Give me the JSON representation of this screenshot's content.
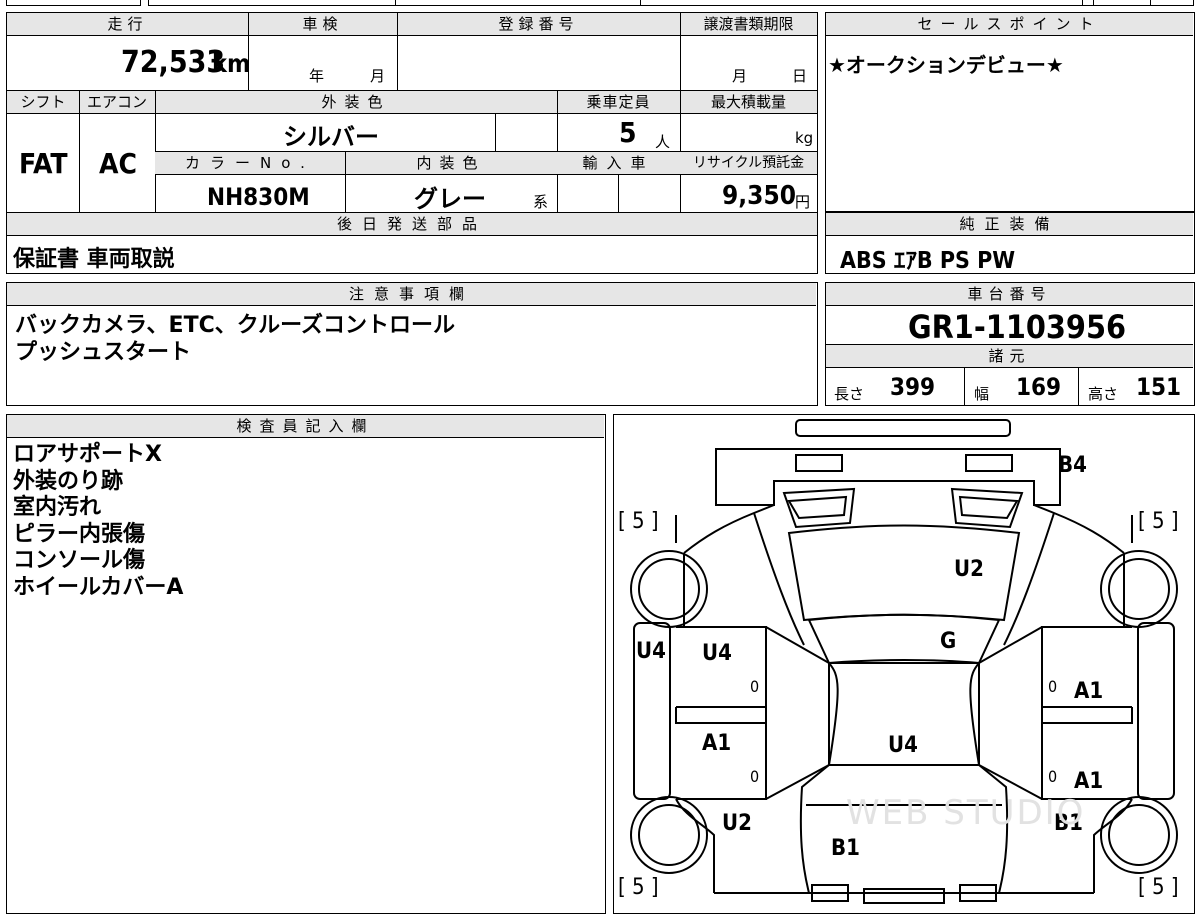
{
  "mileage": {
    "header": "走行",
    "value": "72,533",
    "unit": "km"
  },
  "inspection": {
    "header": "車検",
    "year_unit": "年",
    "month_unit": "月"
  },
  "registration": {
    "header": "登録番号"
  },
  "transfer_deadline": {
    "header": "譲渡書類期限",
    "month_unit": "月",
    "day_unit": "日"
  },
  "sales_point": {
    "header": "セールスポイント",
    "text": "★オークションデビュー★"
  },
  "shift": {
    "header": "シフト",
    "value": "FAT"
  },
  "aircon": {
    "header": "エアコン",
    "value": "AC"
  },
  "exterior_color": {
    "header": "外装色",
    "value": "シルバー"
  },
  "capacity": {
    "header": "乗車定員",
    "value": "5",
    "unit": "人"
  },
  "max_load": {
    "header": "最大積載量",
    "unit": "kg"
  },
  "color_no": {
    "header": "カラーNo.",
    "value": "NH830M"
  },
  "interior_color": {
    "header": "内装色",
    "value": "グレー",
    "suffix": "系"
  },
  "import": {
    "header": "輸入車"
  },
  "recycle": {
    "header": "リサイクル預託金",
    "value": "9,350",
    "unit": "円"
  },
  "later_parts": {
    "header": "後日発送部品",
    "value": "保証書 車両取説"
  },
  "equipment": {
    "header": "純正装備",
    "value": "ABS ｴｱB PS PW"
  },
  "notes": {
    "header": "注意事項欄",
    "lines": "バックカメラ、ETC、クルーズコントロール\nプッシュスタート"
  },
  "chassis": {
    "header": "車台番号",
    "value": "GR1-1103956"
  },
  "specs": {
    "header": "諸元",
    "length_label": "長さ",
    "length": "399",
    "width_label": "幅",
    "width": "169",
    "height_label": "高さ",
    "height": "151"
  },
  "inspector": {
    "header": "検査員記入欄",
    "lines": "ロアサポートX\n外装のり跡\n室内汚れ\nピラー内張傷\nコンソール傷\nホイールカバーA"
  },
  "diagram": {
    "tire_front_left": "[ 5 ]",
    "tire_front_right": "[ 5 ]",
    "tire_rear_left": "[ 5 ]",
    "tire_rear_right": "[ 5 ]",
    "rear_bumper": "B4",
    "roof": "U2",
    "glass": "G",
    "left_edge": "U4",
    "front_door_left": "U4",
    "front_door_right": "A1",
    "rear_door_left": "A1",
    "rear_door_right": "A1",
    "floor": "U4",
    "fender_left": "U2",
    "fender_right": "B1",
    "front_bumper": "B1",
    "mark_fl": "0",
    "mark_fr": "0",
    "mark_rl": "0",
    "mark_rr": "0",
    "watermark": "WEB STUDIO"
  }
}
